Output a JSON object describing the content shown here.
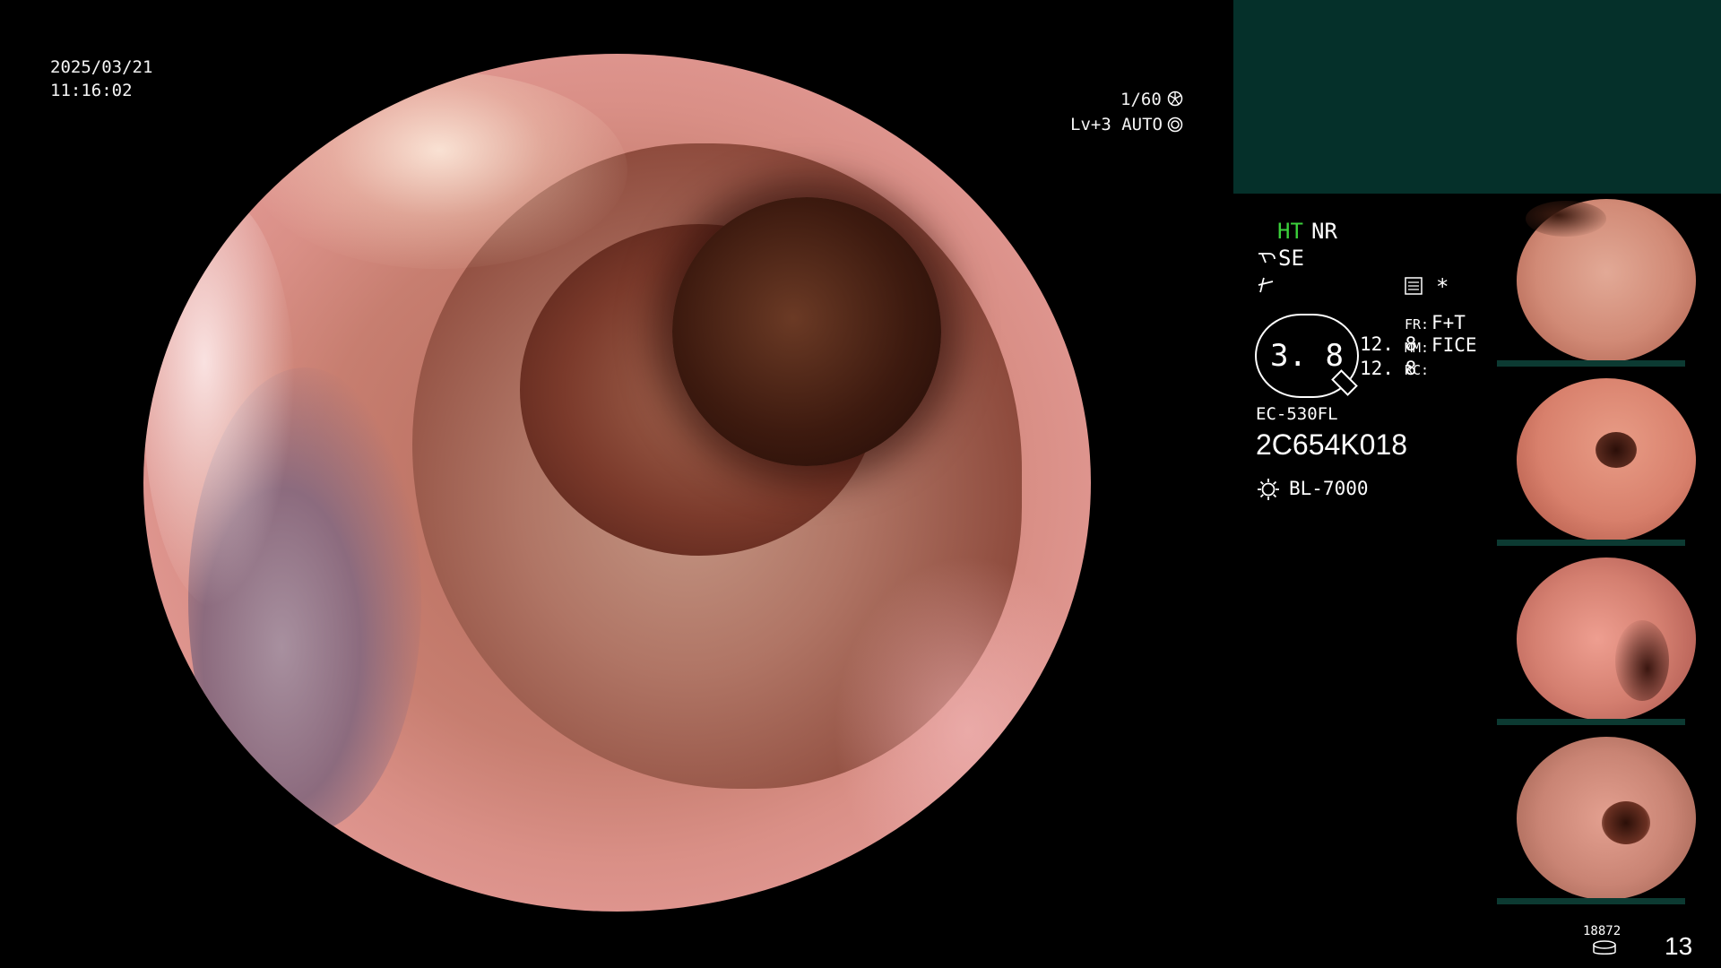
{
  "osd": {
    "date": "2025/03/21",
    "time": "11:16:02",
    "shutter": "1/60",
    "iris": "Lv+3 AUTO"
  },
  "panel": {
    "mode_ht": "HT",
    "mode_nr": "NR",
    "se_label": "SE",
    "star": "*",
    "zoom_value": "3. 8",
    "values": [
      "12. 8",
      "12. 8"
    ],
    "param_labels": [
      "FR:",
      "MM:",
      "RC:"
    ],
    "param_values": [
      "F+T",
      "FICE",
      ""
    ],
    "scope_model": "EC-530FL",
    "scope_serial": "2C654K018",
    "light_source": "BL-7000",
    "counter_small": "18872",
    "counter_big": "13"
  },
  "colors": {
    "ht_green": "#3bd13b",
    "top_panel": "#05302a"
  },
  "icons": [
    "shutter-icon",
    "iris-icon",
    "scope-icon",
    "flash-icon",
    "memory-icon",
    "light-icon",
    "storage-icon"
  ]
}
